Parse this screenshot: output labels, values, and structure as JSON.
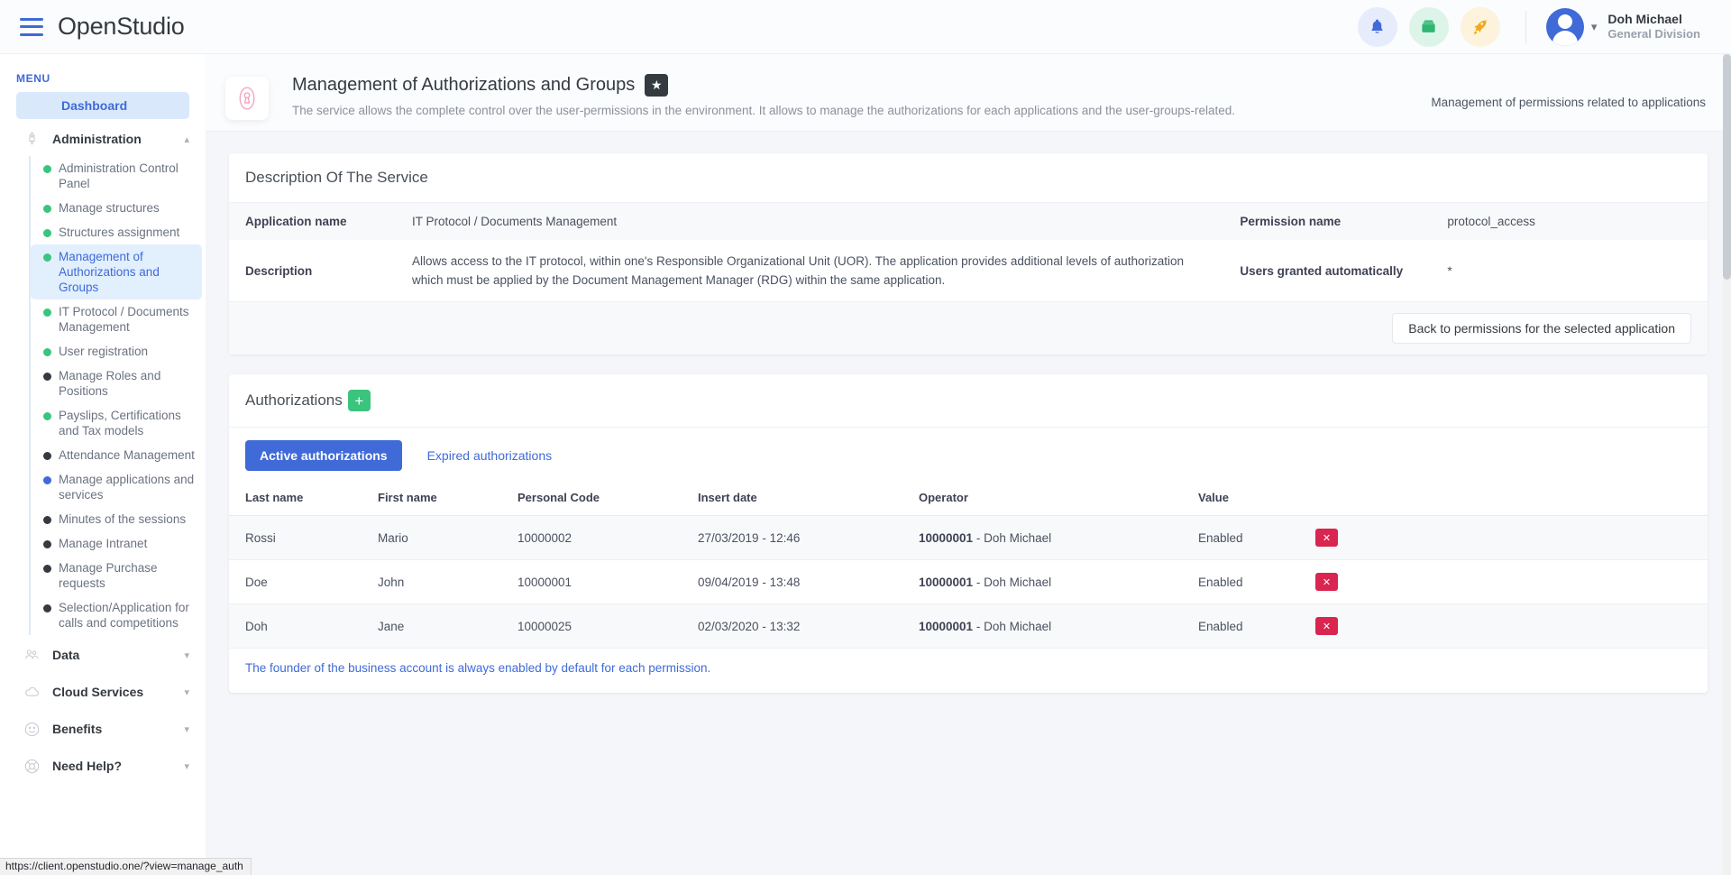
{
  "topbar": {
    "brand": "OpenStudio",
    "menu_icon": "hamburger-icon",
    "actions": [
      {
        "name": "notifications",
        "icon": "bell-icon",
        "color": "#3f6ad8",
        "bg": "#e6ecfb"
      },
      {
        "name": "wallet",
        "icon": "wallet-icon",
        "color": "#3ac47d",
        "bg": "#ddf5e9"
      },
      {
        "name": "upgrade",
        "icon": "rocket-icon",
        "color": "#f7b924",
        "bg": "#fdf3dc"
      }
    ],
    "user": {
      "name": "Doh Michael",
      "division": "General Division"
    }
  },
  "sidebar": {
    "menu_label": "MENU",
    "dashboard": "Dashboard",
    "groups": [
      {
        "label": "Administration",
        "icon": "rocket-icon",
        "expanded": true,
        "items": [
          {
            "label": "Administration Control Panel",
            "dot": "green"
          },
          {
            "label": "Manage structures",
            "dot": "green"
          },
          {
            "label": "Structures assignment",
            "dot": "green"
          },
          {
            "label": "Management of Authorizations and Groups",
            "dot": "green",
            "active": true
          },
          {
            "label": "IT Protocol / Documents Management",
            "dot": "green"
          },
          {
            "label": "User registration",
            "dot": "green"
          },
          {
            "label": "Manage Roles and Positions",
            "dot": "dark"
          },
          {
            "label": "Payslips, Certifications and Tax models",
            "dot": "green"
          },
          {
            "label": "Attendance Management",
            "dot": "dark"
          },
          {
            "label": "Manage applications and services",
            "dot": "blue"
          },
          {
            "label": "Minutes of the sessions",
            "dot": "dark"
          },
          {
            "label": "Manage Intranet",
            "dot": "dark"
          },
          {
            "label": "Manage Purchase requests",
            "dot": "dark"
          },
          {
            "label": "Selection/Application for calls and competitions",
            "dot": "dark"
          }
        ]
      },
      {
        "label": "Data",
        "icon": "users-icon",
        "expanded": false,
        "items": []
      },
      {
        "label": "Cloud Services",
        "icon": "cloud-icon",
        "expanded": false,
        "items": []
      },
      {
        "label": "Benefits",
        "icon": "smile-icon",
        "expanded": false,
        "items": []
      },
      {
        "label": "Need Help?",
        "icon": "lifebuoy-icon",
        "expanded": false,
        "items": []
      }
    ]
  },
  "page_header": {
    "icon": "keyhole-lock-icon",
    "title": "Management of Authorizations and Groups",
    "favorite_icon": "star-icon",
    "subtitle": "The service allows the complete control over the user-permissions in the environment. It allows to manage the authorizations for each applications and the user-groups-related.",
    "right_note": "Management of permissions related to applications"
  },
  "description_card": {
    "title": "Description Of The Service",
    "rows": [
      {
        "left_key": "Application name",
        "left_value": "IT Protocol / Documents Management",
        "right_key": "Permission name",
        "right_value": "protocol_access"
      },
      {
        "left_key": "Description",
        "left_value": "Allows access to the IT protocol, within one's Responsible Organizational Unit (UOR). The application provides additional levels of authorization which must be applied by the Document Management Manager (RDG) within the same application.",
        "right_key": "Users granted automatically",
        "right_value": "*"
      }
    ],
    "back_button": "Back to permissions for the selected application"
  },
  "authorizations_card": {
    "title": "Authorizations",
    "add_button_icon": "plus-icon",
    "tabs": [
      {
        "label": "Active authorizations",
        "active": true
      },
      {
        "label": "Expired authorizations",
        "active": false
      }
    ],
    "columns": [
      "Last name",
      "First name",
      "Personal Code",
      "Insert date",
      "Operator",
      "Value",
      ""
    ],
    "rows": [
      {
        "last_name": "Rossi",
        "first_name": "Mario",
        "personal_code": "10000002",
        "insert_date": "27/03/2019 - 12:46",
        "operator_code": "10000001",
        "operator_name": " - Doh Michael",
        "value": "Enabled",
        "action_icon": "delete-icon"
      },
      {
        "last_name": "Doe",
        "first_name": "John",
        "personal_code": "10000001",
        "insert_date": "09/04/2019 - 13:48",
        "operator_code": "10000001",
        "operator_name": " - Doh Michael",
        "value": "Enabled",
        "action_icon": "delete-icon"
      },
      {
        "last_name": "Doh",
        "first_name": "Jane",
        "personal_code": "10000025",
        "insert_date": "02/03/2020 - 13:32",
        "operator_code": "10000001",
        "operator_name": " - Doh Michael",
        "value": "Enabled",
        "action_icon": "delete-icon"
      }
    ],
    "note": "The founder of the business account is always enabled by default for each permission."
  },
  "statusbar": {
    "url": "https://client.openstudio.one/?view=manage_auth"
  },
  "colors": {
    "primary": "#3f6ad8",
    "success": "#3ac47d",
    "danger": "#d92550",
    "warning": "#f7b924",
    "dark": "#343a40"
  }
}
